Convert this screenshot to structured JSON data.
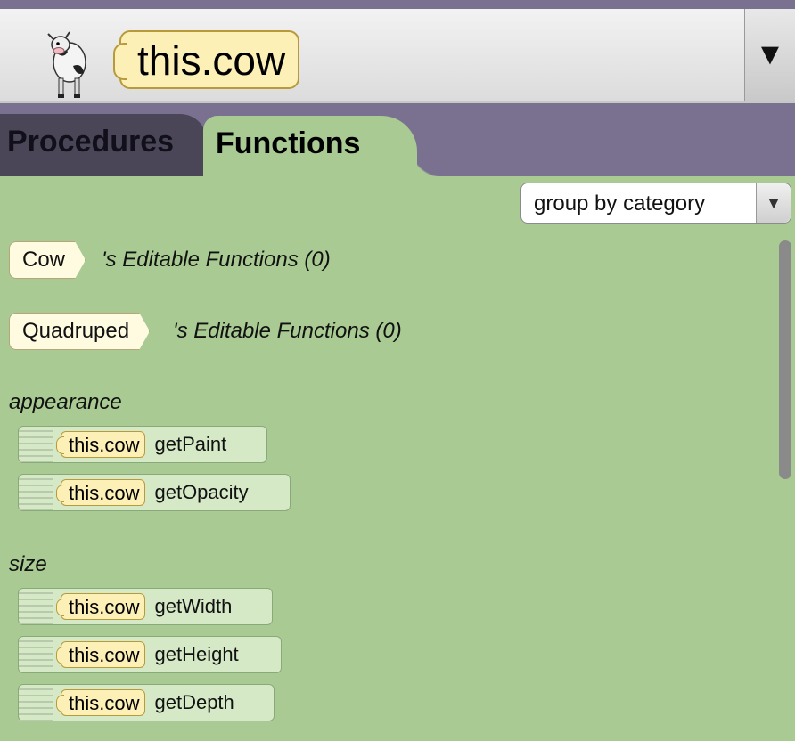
{
  "selector": {
    "value": "this.cow",
    "icon": "cow-icon",
    "arrow": "▼"
  },
  "tabs": [
    {
      "label": "Procedures",
      "selected": false
    },
    {
      "label": "Functions",
      "selected": true
    }
  ],
  "group_by": {
    "value": "group by category",
    "arrow": "▼"
  },
  "editable_functions": [
    {
      "type": "Cow",
      "suffix": "'s Editable Functions (0)"
    },
    {
      "type": "Quadruped",
      "suffix": "'s Editable Functions (0)"
    }
  ],
  "categories": [
    {
      "name": "appearance",
      "functions": [
        {
          "target": "this.cow",
          "name": "getPaint"
        },
        {
          "target": "this.cow",
          "name": "getOpacity"
        }
      ]
    },
    {
      "name": "size",
      "functions": [
        {
          "target": "this.cow",
          "name": "getWidth"
        },
        {
          "target": "this.cow",
          "name": "getHeight"
        },
        {
          "target": "this.cow",
          "name": "getDepth"
        }
      ]
    }
  ],
  "colors": {
    "panel_green": "#a9cb93",
    "tab_bar_purple": "#7a7090",
    "pill_yellow": "#fdf0b7"
  }
}
